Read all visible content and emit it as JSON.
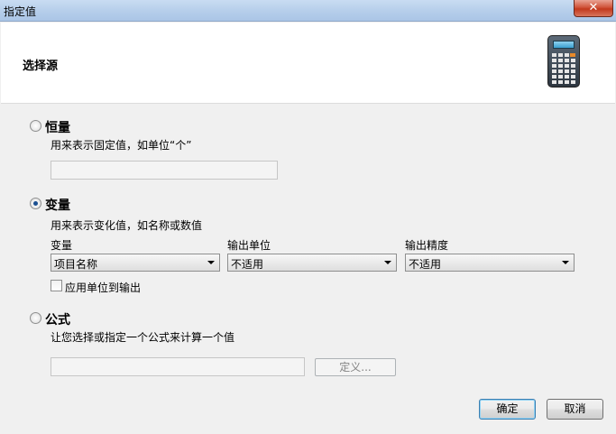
{
  "window": {
    "title": "指定值",
    "close_label": "✕",
    "minimize_label": "▂"
  },
  "header": {
    "title": "选择源",
    "icon": "calculator-icon"
  },
  "constant": {
    "title": "恒量",
    "description": "用来表示固定值，如单位“个”",
    "value": ""
  },
  "variable": {
    "title": "变量",
    "description": "用来表示变化值，如名称或数值",
    "selected": true,
    "variable_label": "变量",
    "variable_value": "项目名称",
    "unit_label": "输出单位",
    "unit_value": "不适用",
    "precision_label": "输出精度",
    "precision_value": "不适用",
    "apply_unit_label": "应用单位到输出",
    "apply_unit_checked": false
  },
  "formula": {
    "title": "公式",
    "description": "让您选择或指定一个公式来计算一个值",
    "value": "",
    "define_label": "定义..."
  },
  "buttons": {
    "ok": "确定",
    "cancel": "取消"
  }
}
